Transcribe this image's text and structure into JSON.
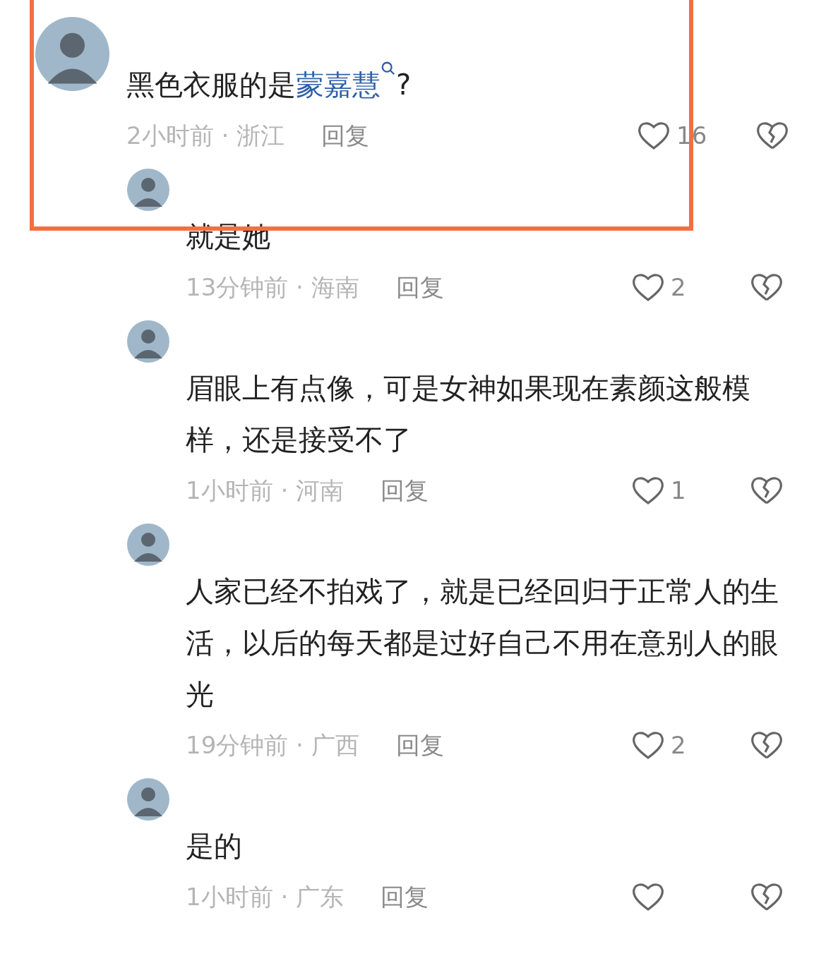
{
  "comments": [
    {
      "text_parts": [
        {
          "kind": "plain",
          "text": "黑色衣服的是"
        },
        {
          "kind": "link",
          "text": "蒙嘉慧"
        },
        {
          "kind": "plain",
          "text": "?"
        }
      ],
      "meta": "2小时前 · 浙江",
      "reply": "回复",
      "likes": "16",
      "highlighted": true,
      "children": [
        {
          "text_parts": [
            {
              "kind": "plain",
              "text": "就是她"
            }
          ],
          "meta": "13分钟前 · 海南",
          "reply": "回复",
          "likes": "2",
          "highlighted": false
        },
        {
          "text_parts": [
            {
              "kind": "plain",
              "text": "眉眼上有点像，可是女神如果现在素颜这般模样，还是接受不了"
            }
          ],
          "meta": "1小时前 · 河南",
          "reply": "回复",
          "likes": "1",
          "highlighted": false
        },
        {
          "text_parts": [
            {
              "kind": "plain",
              "text": "人家已经不拍戏了，就是已经回归于正常人的生活，以后的每天都是过好自己不用在意别人的眼光"
            }
          ],
          "meta": "19分钟前 · 广西",
          "reply": "回复",
          "likes": "2",
          "highlighted": false
        },
        {
          "text_parts": [
            {
              "kind": "plain",
              "text": "是的"
            }
          ],
          "meta": "1小时前 · 广东",
          "reply": "回复",
          "highlighted": false
        }
      ]
    }
  ]
}
